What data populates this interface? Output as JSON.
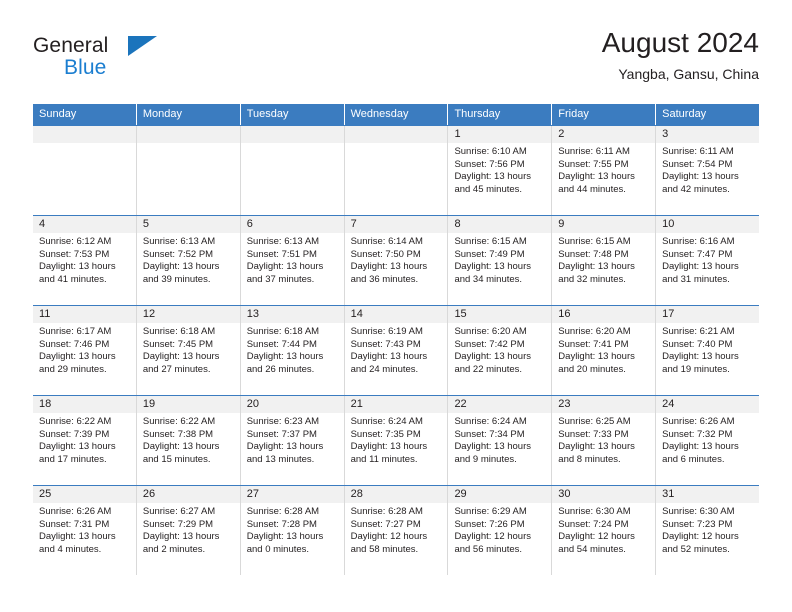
{
  "brand": {
    "name_part1": "General",
    "name_part2": "Blue",
    "triangle_icon": "triangle-icon",
    "blue": "#1b7ed0",
    "dark": "#231f20"
  },
  "header": {
    "title": "August 2024",
    "subtitle": "Yangba, Gansu, China"
  },
  "theme": {
    "header_blue": "#3b7cc0",
    "daynum_bg": "#f1f1f1",
    "cell_border": "#d9d9d9",
    "text": "#231f20"
  },
  "weekdays": [
    "Sunday",
    "Monday",
    "Tuesday",
    "Wednesday",
    "Thursday",
    "Friday",
    "Saturday"
  ],
  "labels": {
    "sunrise": "Sunrise:",
    "sunset": "Sunset:",
    "daylight": "Daylight:"
  },
  "weeks": [
    [
      {
        "day": "",
        "sunrise": "",
        "sunset": "",
        "daylight_1": "",
        "daylight_2": ""
      },
      {
        "day": "",
        "sunrise": "",
        "sunset": "",
        "daylight_1": "",
        "daylight_2": ""
      },
      {
        "day": "",
        "sunrise": "",
        "sunset": "",
        "daylight_1": "",
        "daylight_2": ""
      },
      {
        "day": "",
        "sunrise": "",
        "sunset": "",
        "daylight_1": "",
        "daylight_2": ""
      },
      {
        "day": "1",
        "sunrise": "Sunrise: 6:10 AM",
        "sunset": "Sunset: 7:56 PM",
        "daylight_1": "Daylight: 13 hours",
        "daylight_2": "and 45 minutes."
      },
      {
        "day": "2",
        "sunrise": "Sunrise: 6:11 AM",
        "sunset": "Sunset: 7:55 PM",
        "daylight_1": "Daylight: 13 hours",
        "daylight_2": "and 44 minutes."
      },
      {
        "day": "3",
        "sunrise": "Sunrise: 6:11 AM",
        "sunset": "Sunset: 7:54 PM",
        "daylight_1": "Daylight: 13 hours",
        "daylight_2": "and 42 minutes."
      }
    ],
    [
      {
        "day": "4",
        "sunrise": "Sunrise: 6:12 AM",
        "sunset": "Sunset: 7:53 PM",
        "daylight_1": "Daylight: 13 hours",
        "daylight_2": "and 41 minutes."
      },
      {
        "day": "5",
        "sunrise": "Sunrise: 6:13 AM",
        "sunset": "Sunset: 7:52 PM",
        "daylight_1": "Daylight: 13 hours",
        "daylight_2": "and 39 minutes."
      },
      {
        "day": "6",
        "sunrise": "Sunrise: 6:13 AM",
        "sunset": "Sunset: 7:51 PM",
        "daylight_1": "Daylight: 13 hours",
        "daylight_2": "and 37 minutes."
      },
      {
        "day": "7",
        "sunrise": "Sunrise: 6:14 AM",
        "sunset": "Sunset: 7:50 PM",
        "daylight_1": "Daylight: 13 hours",
        "daylight_2": "and 36 minutes."
      },
      {
        "day": "8",
        "sunrise": "Sunrise: 6:15 AM",
        "sunset": "Sunset: 7:49 PM",
        "daylight_1": "Daylight: 13 hours",
        "daylight_2": "and 34 minutes."
      },
      {
        "day": "9",
        "sunrise": "Sunrise: 6:15 AM",
        "sunset": "Sunset: 7:48 PM",
        "daylight_1": "Daylight: 13 hours",
        "daylight_2": "and 32 minutes."
      },
      {
        "day": "10",
        "sunrise": "Sunrise: 6:16 AM",
        "sunset": "Sunset: 7:47 PM",
        "daylight_1": "Daylight: 13 hours",
        "daylight_2": "and 31 minutes."
      }
    ],
    [
      {
        "day": "11",
        "sunrise": "Sunrise: 6:17 AM",
        "sunset": "Sunset: 7:46 PM",
        "daylight_1": "Daylight: 13 hours",
        "daylight_2": "and 29 minutes."
      },
      {
        "day": "12",
        "sunrise": "Sunrise: 6:18 AM",
        "sunset": "Sunset: 7:45 PM",
        "daylight_1": "Daylight: 13 hours",
        "daylight_2": "and 27 minutes."
      },
      {
        "day": "13",
        "sunrise": "Sunrise: 6:18 AM",
        "sunset": "Sunset: 7:44 PM",
        "daylight_1": "Daylight: 13 hours",
        "daylight_2": "and 26 minutes."
      },
      {
        "day": "14",
        "sunrise": "Sunrise: 6:19 AM",
        "sunset": "Sunset: 7:43 PM",
        "daylight_1": "Daylight: 13 hours",
        "daylight_2": "and 24 minutes."
      },
      {
        "day": "15",
        "sunrise": "Sunrise: 6:20 AM",
        "sunset": "Sunset: 7:42 PM",
        "daylight_1": "Daylight: 13 hours",
        "daylight_2": "and 22 minutes."
      },
      {
        "day": "16",
        "sunrise": "Sunrise: 6:20 AM",
        "sunset": "Sunset: 7:41 PM",
        "daylight_1": "Daylight: 13 hours",
        "daylight_2": "and 20 minutes."
      },
      {
        "day": "17",
        "sunrise": "Sunrise: 6:21 AM",
        "sunset": "Sunset: 7:40 PM",
        "daylight_1": "Daylight: 13 hours",
        "daylight_2": "and 19 minutes."
      }
    ],
    [
      {
        "day": "18",
        "sunrise": "Sunrise: 6:22 AM",
        "sunset": "Sunset: 7:39 PM",
        "daylight_1": "Daylight: 13 hours",
        "daylight_2": "and 17 minutes."
      },
      {
        "day": "19",
        "sunrise": "Sunrise: 6:22 AM",
        "sunset": "Sunset: 7:38 PM",
        "daylight_1": "Daylight: 13 hours",
        "daylight_2": "and 15 minutes."
      },
      {
        "day": "20",
        "sunrise": "Sunrise: 6:23 AM",
        "sunset": "Sunset: 7:37 PM",
        "daylight_1": "Daylight: 13 hours",
        "daylight_2": "and 13 minutes."
      },
      {
        "day": "21",
        "sunrise": "Sunrise: 6:24 AM",
        "sunset": "Sunset: 7:35 PM",
        "daylight_1": "Daylight: 13 hours",
        "daylight_2": "and 11 minutes."
      },
      {
        "day": "22",
        "sunrise": "Sunrise: 6:24 AM",
        "sunset": "Sunset: 7:34 PM",
        "daylight_1": "Daylight: 13 hours",
        "daylight_2": "and 9 minutes."
      },
      {
        "day": "23",
        "sunrise": "Sunrise: 6:25 AM",
        "sunset": "Sunset: 7:33 PM",
        "daylight_1": "Daylight: 13 hours",
        "daylight_2": "and 8 minutes."
      },
      {
        "day": "24",
        "sunrise": "Sunrise: 6:26 AM",
        "sunset": "Sunset: 7:32 PM",
        "daylight_1": "Daylight: 13 hours",
        "daylight_2": "and 6 minutes."
      }
    ],
    [
      {
        "day": "25",
        "sunrise": "Sunrise: 6:26 AM",
        "sunset": "Sunset: 7:31 PM",
        "daylight_1": "Daylight: 13 hours",
        "daylight_2": "and 4 minutes."
      },
      {
        "day": "26",
        "sunrise": "Sunrise: 6:27 AM",
        "sunset": "Sunset: 7:29 PM",
        "daylight_1": "Daylight: 13 hours",
        "daylight_2": "and 2 minutes."
      },
      {
        "day": "27",
        "sunrise": "Sunrise: 6:28 AM",
        "sunset": "Sunset: 7:28 PM",
        "daylight_1": "Daylight: 13 hours",
        "daylight_2": "and 0 minutes."
      },
      {
        "day": "28",
        "sunrise": "Sunrise: 6:28 AM",
        "sunset": "Sunset: 7:27 PM",
        "daylight_1": "Daylight: 12 hours",
        "daylight_2": "and 58 minutes."
      },
      {
        "day": "29",
        "sunrise": "Sunrise: 6:29 AM",
        "sunset": "Sunset: 7:26 PM",
        "daylight_1": "Daylight: 12 hours",
        "daylight_2": "and 56 minutes."
      },
      {
        "day": "30",
        "sunrise": "Sunrise: 6:30 AM",
        "sunset": "Sunset: 7:24 PM",
        "daylight_1": "Daylight: 12 hours",
        "daylight_2": "and 54 minutes."
      },
      {
        "day": "31",
        "sunrise": "Sunrise: 6:30 AM",
        "sunset": "Sunset: 7:23 PM",
        "daylight_1": "Daylight: 12 hours",
        "daylight_2": "and 52 minutes."
      }
    ]
  ]
}
